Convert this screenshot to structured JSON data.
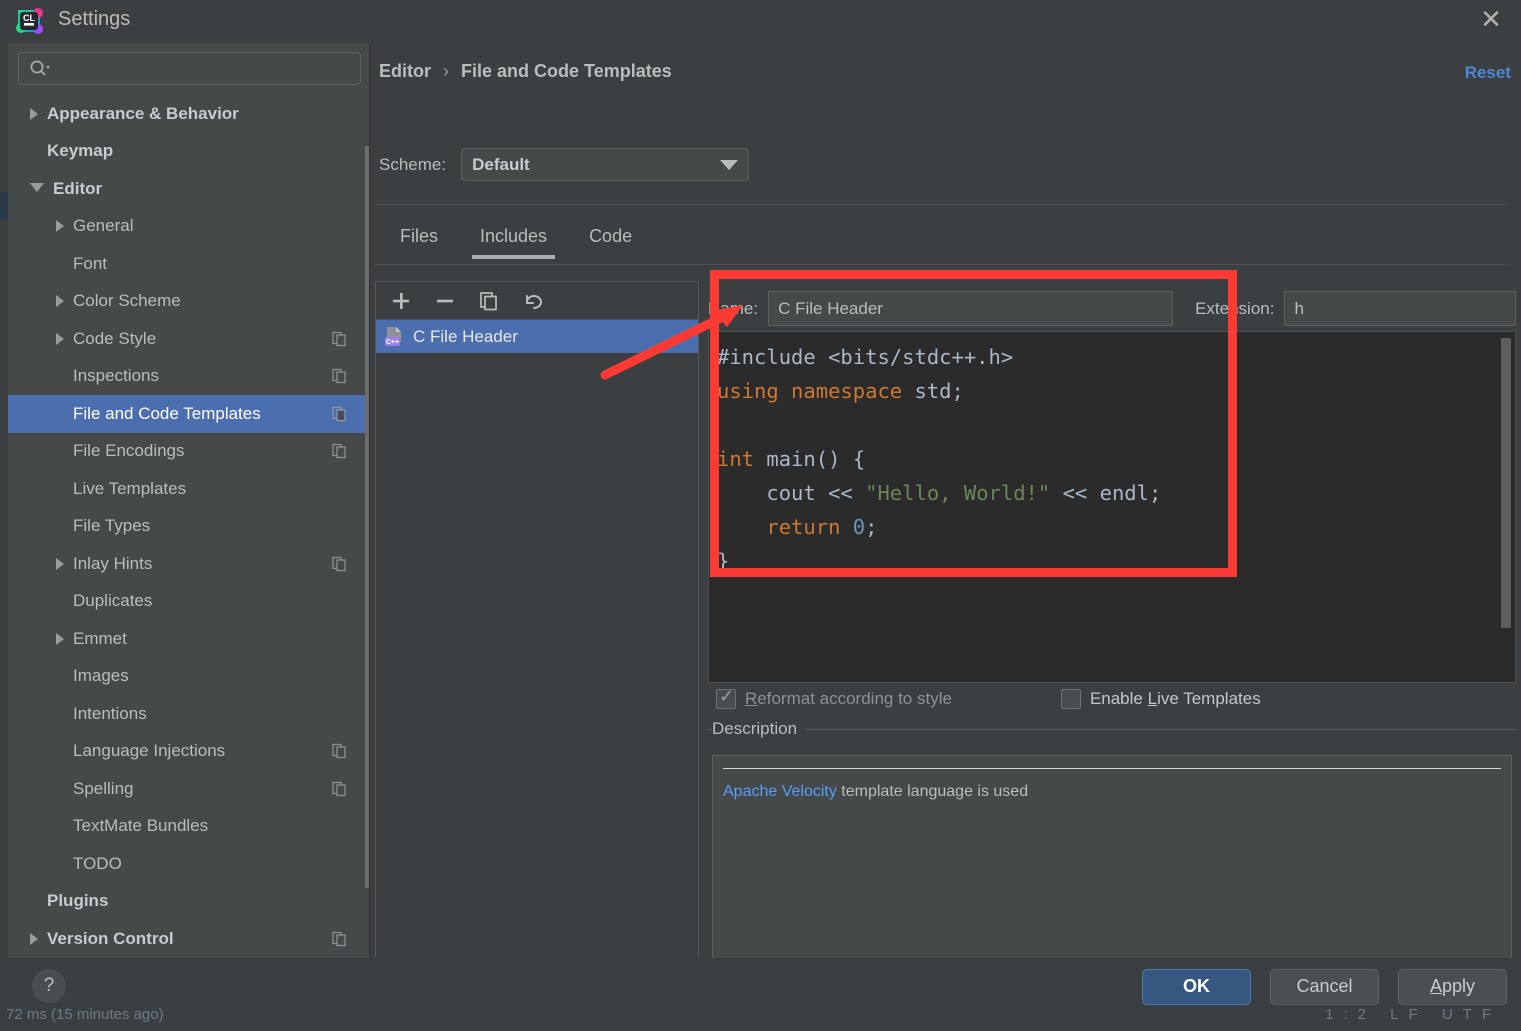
{
  "window": {
    "title": "Settings",
    "app_icon": "clion-icon",
    "close_icon": "close-icon"
  },
  "search": {
    "placeholder": "",
    "value": "",
    "icon": "search-icon"
  },
  "sidebar": {
    "items": [
      {
        "label": "Appearance & Behavior",
        "indent": 0,
        "arrow": "right",
        "bold": true,
        "badge": false,
        "selected": false
      },
      {
        "label": "Keymap",
        "indent": 0,
        "arrow": "none",
        "bold": true,
        "badge": false,
        "selected": false
      },
      {
        "label": "Editor",
        "indent": 0,
        "arrow": "down",
        "bold": true,
        "badge": false,
        "selected": false
      },
      {
        "label": "General",
        "indent": 1,
        "arrow": "right",
        "bold": false,
        "badge": false,
        "selected": false
      },
      {
        "label": "Font",
        "indent": 1,
        "arrow": "none",
        "bold": false,
        "badge": false,
        "selected": false
      },
      {
        "label": "Color Scheme",
        "indent": 1,
        "arrow": "right",
        "bold": false,
        "badge": false,
        "selected": false
      },
      {
        "label": "Code Style",
        "indent": 1,
        "arrow": "right",
        "bold": false,
        "badge": true,
        "selected": false
      },
      {
        "label": "Inspections",
        "indent": 1,
        "arrow": "none",
        "bold": false,
        "badge": true,
        "selected": false
      },
      {
        "label": "File and Code Templates",
        "indent": 1,
        "arrow": "none",
        "bold": false,
        "badge": true,
        "selected": true
      },
      {
        "label": "File Encodings",
        "indent": 1,
        "arrow": "none",
        "bold": false,
        "badge": true,
        "selected": false
      },
      {
        "label": "Live Templates",
        "indent": 1,
        "arrow": "none",
        "bold": false,
        "badge": false,
        "selected": false
      },
      {
        "label": "File Types",
        "indent": 1,
        "arrow": "none",
        "bold": false,
        "badge": false,
        "selected": false
      },
      {
        "label": "Inlay Hints",
        "indent": 1,
        "arrow": "right",
        "bold": false,
        "badge": true,
        "selected": false
      },
      {
        "label": "Duplicates",
        "indent": 1,
        "arrow": "none",
        "bold": false,
        "badge": false,
        "selected": false
      },
      {
        "label": "Emmet",
        "indent": 1,
        "arrow": "right",
        "bold": false,
        "badge": false,
        "selected": false
      },
      {
        "label": "Images",
        "indent": 1,
        "arrow": "none",
        "bold": false,
        "badge": false,
        "selected": false
      },
      {
        "label": "Intentions",
        "indent": 1,
        "arrow": "none",
        "bold": false,
        "badge": false,
        "selected": false
      },
      {
        "label": "Language Injections",
        "indent": 1,
        "arrow": "none",
        "bold": false,
        "badge": true,
        "selected": false
      },
      {
        "label": "Spelling",
        "indent": 1,
        "arrow": "none",
        "bold": false,
        "badge": true,
        "selected": false
      },
      {
        "label": "TextMate Bundles",
        "indent": 1,
        "arrow": "none",
        "bold": false,
        "badge": false,
        "selected": false
      },
      {
        "label": "TODO",
        "indent": 1,
        "arrow": "none",
        "bold": false,
        "badge": false,
        "selected": false
      },
      {
        "label": "Plugins",
        "indent": 0,
        "arrow": "none",
        "bold": true,
        "badge": false,
        "selected": false
      },
      {
        "label": "Version Control",
        "indent": 0,
        "arrow": "right",
        "bold": true,
        "badge": true,
        "selected": false
      }
    ]
  },
  "main": {
    "breadcrumb": {
      "parent": "Editor",
      "separator": "›",
      "current": "File and Code Templates"
    },
    "reset_label": "Reset",
    "scheme": {
      "label": "Scheme:",
      "value": "Default"
    },
    "tabs": [
      {
        "label": "Files",
        "active": false
      },
      {
        "label": "Includes",
        "active": true
      },
      {
        "label": "Code",
        "active": false
      }
    ]
  },
  "template_list": {
    "toolbar": [
      {
        "icon": "add-icon",
        "label": "+"
      },
      {
        "icon": "remove-icon",
        "label": "−"
      },
      {
        "icon": "copy-icon",
        "label": ""
      },
      {
        "icon": "revert-icon",
        "label": ""
      }
    ],
    "rows": [
      {
        "label": "C File Header",
        "icon": "cpp-file-icon",
        "selected": true
      }
    ]
  },
  "template_editor": {
    "name_label": "Name:",
    "name_value": "C File Header",
    "extension_label": "Extension:",
    "extension_value": "h",
    "code_lines": [
      [
        {
          "t": "caret",
          "v": ""
        },
        {
          "t": "plain",
          "v": "#include <bits/stdc++.h>"
        }
      ],
      [
        {
          "t": "orange",
          "v": "using namespace"
        },
        {
          "t": "plain",
          "v": " std;"
        }
      ],
      [
        {
          "t": "plain",
          "v": ""
        }
      ],
      [
        {
          "t": "orange",
          "v": "int"
        },
        {
          "t": "plain",
          "v": " main() {"
        }
      ],
      [
        {
          "t": "plain",
          "v": "    cout << "
        },
        {
          "t": "str",
          "v": "\"Hello, World!\""
        },
        {
          "t": "plain",
          "v": " << endl;"
        }
      ],
      [
        {
          "t": "plain",
          "v": "    "
        },
        {
          "t": "orange",
          "v": "return"
        },
        {
          "t": "plain",
          "v": " "
        },
        {
          "t": "num",
          "v": "0"
        },
        {
          "t": "plain",
          "v": ";"
        }
      ],
      [
        {
          "t": "plain",
          "v": "}"
        }
      ]
    ],
    "checkbox_reformat": {
      "label_prefix": "",
      "label_underline": "R",
      "label_suffix": "eformat according to style",
      "checked": true
    },
    "checkbox_live_templates": {
      "label_prefix": "Enable ",
      "label_underline": "L",
      "label_suffix": "ive Templates",
      "checked": false
    },
    "description_title": "Description",
    "description_link": "Apache Velocity",
    "description_text": " template language is used"
  },
  "footer": {
    "help_label": "?",
    "buttons": [
      {
        "label": "OK",
        "underline": "",
        "primary": true
      },
      {
        "label": "Cancel",
        "underline": "",
        "primary": false
      },
      {
        "label": "Apply",
        "underline": "A",
        "primary": false
      }
    ]
  },
  "backdrop": {
    "status_left": "72 ms (15 minutes ago)",
    "status_right": "1:2  LF  UTF"
  },
  "annotation": {
    "rect_color": "#fb3a34",
    "arrow_color": "#fb3a34",
    "target": "code-editor-first-line-caret"
  }
}
